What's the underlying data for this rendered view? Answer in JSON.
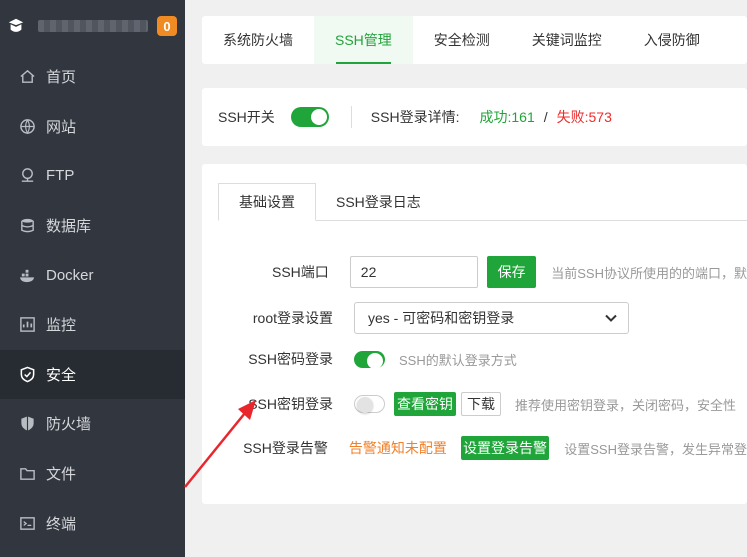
{
  "sidebar": {
    "badge": "0",
    "items": [
      {
        "label": "首页",
        "icon": "home-icon"
      },
      {
        "label": "网站",
        "icon": "globe-icon"
      },
      {
        "label": "FTP",
        "icon": "ftp-icon"
      },
      {
        "label": "数据库",
        "icon": "database-icon"
      },
      {
        "label": "Docker",
        "icon": "docker-icon"
      },
      {
        "label": "监控",
        "icon": "monitor-icon"
      },
      {
        "label": "安全",
        "icon": "shield-check-icon",
        "active": true
      },
      {
        "label": "防火墙",
        "icon": "firewall-shield-icon"
      },
      {
        "label": "文件",
        "icon": "folder-icon"
      },
      {
        "label": "终端",
        "icon": "terminal-icon"
      }
    ]
  },
  "tabs": [
    "系统防火墙",
    "SSH管理",
    "安全检测",
    "关键词监控",
    "入侵防御"
  ],
  "ssh_bar": {
    "switch_label": "SSH开关",
    "switch_on": true,
    "detail_label": "SSH登录详情:",
    "success_label": "成功:",
    "success_count": "161",
    "separator": "/",
    "fail_label": "失败:",
    "fail_count": "573"
  },
  "subtabs": [
    "基础设置",
    "SSH登录日志"
  ],
  "form": {
    "port_label": "SSH端口",
    "port_value": "22",
    "save_label": "保存",
    "port_hint": "当前SSH协议所使用的的端口，默",
    "root_label": "root登录设置",
    "root_value": "yes - 可密码和密钥登录",
    "pwd_login_label": "SSH密码登录",
    "pwd_login_on": true,
    "pwd_login_hint": "SSH的默认登录方式",
    "key_login_label": "SSH密钥登录",
    "key_login_on": false,
    "view_key_label": "查看密钥",
    "download_label": "下载",
    "key_login_hint": "推荐使用密钥登录，关闭密码，安全性",
    "alert_label": "SSH登录告警",
    "alert_status": "告警通知未配置",
    "alert_button": "设置登录告警",
    "alert_hint": "设置SSH登录告警，发生异常登"
  },
  "colors": {
    "accent": "#20a53a",
    "sidebar_bg": "#31363f",
    "badge": "#f08b23",
    "fail": "#ef2b2b",
    "warn": "#f0802a",
    "arrow": "#e8262b"
  }
}
